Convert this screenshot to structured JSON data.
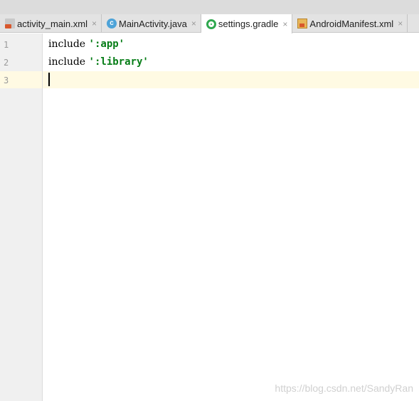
{
  "tabs": [
    {
      "label": "activity_main.xml",
      "icon": "layout-xml-icon",
      "close": "×",
      "active": false
    },
    {
      "label": "MainActivity.java",
      "icon": "java-class-icon",
      "icon_letter": "c",
      "close": "×",
      "active": false
    },
    {
      "label": "settings.gradle",
      "icon": "gradle-icon",
      "close": "×",
      "active": true
    },
    {
      "label": "AndroidManifest.xml",
      "icon": "manifest-icon",
      "close": "×",
      "active": false
    }
  ],
  "editor": {
    "line_numbers": [
      "1",
      "2",
      "3"
    ],
    "lines": [
      {
        "keyword": "include",
        "string": "':app'"
      },
      {
        "keyword": "include",
        "string": "':library'"
      },
      {
        "keyword": "",
        "string": ""
      }
    ],
    "current_line": "3"
  },
  "watermark": "https://blog.csdn.net/SandyRan",
  "colors": {
    "string": "#067d17",
    "current_line_bg": "#fffae3",
    "gutter_bg": "#f0f0f0"
  }
}
